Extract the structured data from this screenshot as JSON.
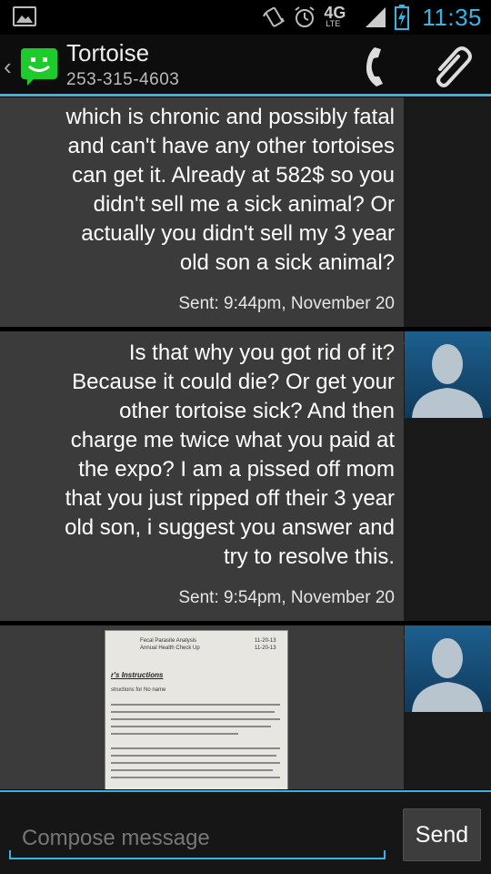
{
  "status_bar": {
    "time": "11:35",
    "network_label": "4G",
    "network_sub": "LTE",
    "icons": [
      "gallery-icon",
      "vibrate-icon",
      "alarm-icon",
      "network-4g-lte-icon",
      "signal-icon",
      "battery-charging-icon"
    ]
  },
  "header": {
    "contact_name": "Tortoise",
    "contact_number": "253-315-4603",
    "back_symbol": "‹",
    "icons": [
      "messaging-app-icon",
      "phone-icon",
      "paperclip-icon"
    ]
  },
  "messages": [
    {
      "direction": "incoming",
      "lines": [
        "which is chronic and possibly fatal",
        "and can't have any other tortoises",
        "can get it. Already at 582$ so you",
        "didn't sell me a sick animal? Or",
        "actually you didn't sell my 3 year",
        "old son a sick animal?"
      ],
      "sent": "Sent: 9:44pm, November 20"
    },
    {
      "direction": "outgoing",
      "lines": [
        "Is that why you got rid of it?",
        "Because it could die? Or get your",
        "other tortoise sick? And then",
        "charge me twice what you paid at",
        "the expo? I am a pissed off mom",
        "that you just ripped off their 3 year",
        "old son, i suggest you answer and",
        "try to resolve this."
      ],
      "sent": "Sent: 9:54pm, November 20"
    },
    {
      "direction": "outgoing",
      "attachment": {
        "kind": "image",
        "header_left_1": "Fecal Parasite Analysis",
        "header_left_2": "Annual Health Check Up",
        "header_right_1": "11-20-13",
        "header_right_2": "11-20-13",
        "heading": "r's Instructions",
        "subheading": "structions for No name"
      }
    }
  ],
  "compose": {
    "placeholder": "Compose message",
    "send_label": "Send"
  },
  "colors": {
    "accent": "#33b5e5",
    "bubble": "#3b3b3b",
    "background": "#000000"
  }
}
